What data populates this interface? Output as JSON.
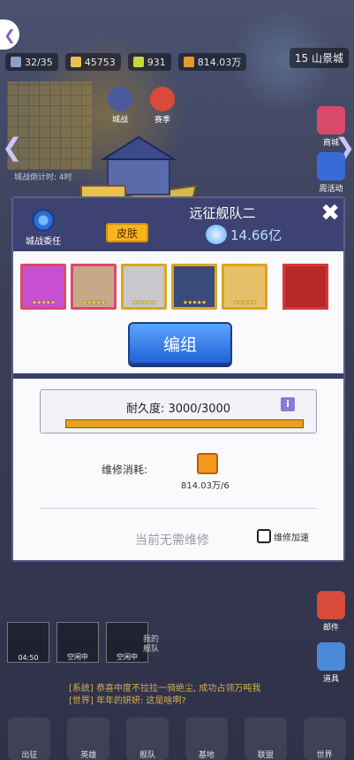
{
  "topbar": {
    "ships": "32/35",
    "gold": "45753",
    "gems": "931",
    "fuel": "814.03万",
    "city": "15 山景城"
  },
  "map": {
    "countdown": "城战倒计时: 4时",
    "city_war": "城战",
    "rivals": "赛季"
  },
  "panel": {
    "title": "远征舰队二",
    "close": "✖",
    "setting_label": "城战委任",
    "skin_label": "皮肤",
    "power": "14.66亿",
    "form_button": "编组",
    "heroes": [
      {
        "stars": "★★★★★",
        "color": "#c94fd1"
      },
      {
        "stars": "★★★★★",
        "color": "#c9a888"
      },
      {
        "stars": "★★★★★",
        "color": "#c8c8cc"
      },
      {
        "stars": "★★★★★",
        "color": "#3a4a7a"
      },
      {
        "stars": "★★★★★",
        "color": "#e8c06a"
      }
    ],
    "durability_label": "耐久度: 3000/3000",
    "durability_fraction": 1.0,
    "info": "i",
    "repair_cost_label": "维修消耗:",
    "repair_cost_value": "814.03万/6",
    "no_repair": "当前无需维修",
    "accel_label": "维修加速"
  },
  "side_right": {
    "shop": "商城",
    "events": "周活动",
    "mail": "邮件",
    "items": "道具"
  },
  "queue": {
    "slot1": "04:50",
    "slot2": "空闲中",
    "slot3": "空闲中",
    "my_fleet": "我的舰队"
  },
  "chat": {
    "line1": "[系统] 恭喜中度不拉拉一骑绝尘, 成功占领万吨我",
    "line2": "[世界] 年年的妍妍: 这是啥啊?"
  },
  "nav": [
    "出征",
    "英雄",
    "舰队",
    "基地",
    "联盟",
    "世界"
  ]
}
